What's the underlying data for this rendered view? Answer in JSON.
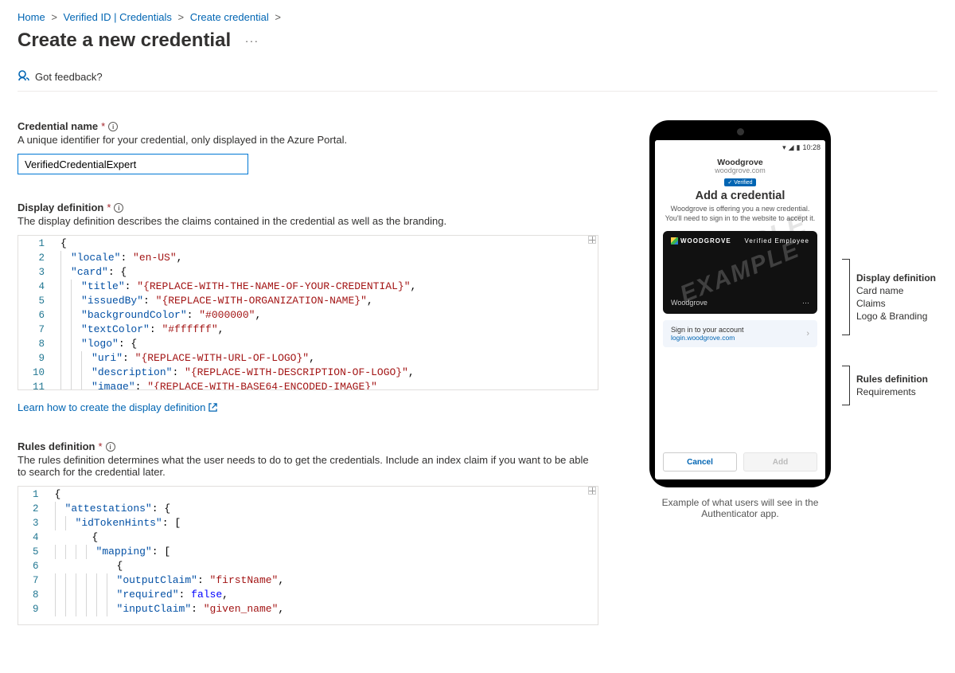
{
  "breadcrumb": {
    "home": "Home",
    "vid": "Verified ID | Credentials",
    "create": "Create credential"
  },
  "page": {
    "title": "Create a new credential",
    "more": "...",
    "feedback_label": "Got feedback?"
  },
  "form": {
    "name_label": "Credential name",
    "name_desc": "A unique identifier for your credential, only displayed in the Azure Portal.",
    "name_value": "VerifiedCredentialExpert",
    "display_label": "Display definition",
    "display_desc": "The display definition describes the claims contained in the credential as well as the branding.",
    "learn_display": "Learn how to create the display definition",
    "rules_label": "Rules definition",
    "rules_desc": "The rules definition determines what the user needs to do to get the credentials. Include an index claim if you want to be able to search for the credential later."
  },
  "display_json": {
    "lines": [
      [
        "{"
      ],
      [
        "  ",
        "\"locale\"",
        ": ",
        "\"en-US\"",
        ","
      ],
      [
        "  ",
        "\"card\"",
        ": {"
      ],
      [
        "    ",
        "\"title\"",
        ": ",
        "\"{REPLACE-WITH-THE-NAME-OF-YOUR-CREDENTIAL}\"",
        ","
      ],
      [
        "    ",
        "\"issuedBy\"",
        ": ",
        "\"{REPLACE-WITH-ORGANIZATION-NAME}\"",
        ","
      ],
      [
        "    ",
        "\"backgroundColor\"",
        ": ",
        "\"#000000\"",
        ","
      ],
      [
        "    ",
        "\"textColor\"",
        ": ",
        "\"#ffffff\"",
        ","
      ],
      [
        "    ",
        "\"logo\"",
        ": {"
      ],
      [
        "      ",
        "\"uri\"",
        ": ",
        "\"{REPLACE-WITH-URL-OF-LOGO}\"",
        ","
      ],
      [
        "      ",
        "\"description\"",
        ": ",
        "\"{REPLACE-WITH-DESCRIPTION-OF-LOGO}\"",
        ","
      ],
      [
        "      ",
        "\"image\"",
        ": ",
        "\"{REPLACE-WITH-BASE64-ENCODED-IMAGE}\""
      ]
    ],
    "line_numbers": [
      "1",
      "2",
      "3",
      "4",
      "5",
      "6",
      "7",
      "8",
      "9",
      "10",
      "11"
    ]
  },
  "rules_json": {
    "lines": [
      [
        "{"
      ],
      [
        "  ",
        "\"attestations\"",
        ": {"
      ],
      [
        "    ",
        "\"idTokenHints\"",
        ": ["
      ],
      [
        "      {"
      ],
      [
        "        ",
        "\"mapping\"",
        ": ["
      ],
      [
        "          {"
      ],
      [
        "            ",
        "\"outputClaim\"",
        ": ",
        "\"firstName\"",
        ","
      ],
      [
        "            ",
        "\"required\"",
        ": ",
        "false",
        ","
      ],
      [
        "            ",
        "\"inputClaim\"",
        ": ",
        "\"given_name\"",
        ","
      ]
    ],
    "line_numbers": [
      "1",
      "2",
      "3",
      "4",
      "5",
      "6",
      "7",
      "8",
      "9"
    ]
  },
  "preview": {
    "time": "10:28",
    "brand": "Woodgrove",
    "domain": "woodgrove.com",
    "verified": "✓ Verified",
    "heading": "Add a credential",
    "body": "Woodgrove is offering you a new credential. You'll need to sign in to the website to accept it.",
    "card_brand": "WOODGROVE",
    "card_type": "Verified Employee",
    "card_issuer": "Woodgrove",
    "signin_title": "Sign in to your account",
    "signin_sub": "login.woodgrove.com",
    "cancel": "Cancel",
    "add": "Add",
    "watermark": "EXAMPLE",
    "caption": "Example of what users will see in the Authenticator app."
  },
  "annotations": {
    "display_title": "Display definition",
    "display_items": [
      "Card name",
      "Claims",
      "Logo & Branding"
    ],
    "rules_title": "Rules definition",
    "rules_items": [
      "Requirements"
    ]
  }
}
